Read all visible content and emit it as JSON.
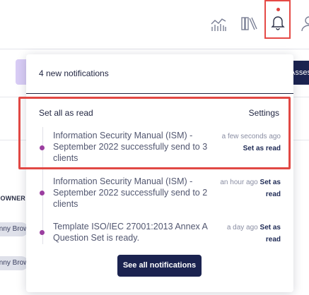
{
  "topbar": {
    "icons": [
      "chart-icon",
      "library-icon",
      "bell-icon",
      "user-icon"
    ],
    "bell_has_unread": true
  },
  "background": {
    "right_button_label": "Assessm",
    "owner_column_header": "CLIENT OWNER",
    "owner_rows": [
      "Danny Brown",
      "Danny Brown"
    ]
  },
  "notifications_panel": {
    "header": "4 new notifications",
    "set_all_read": "Set all as read",
    "settings": "Settings",
    "items": [
      {
        "text": "Information Security Manual (ISM) - September 2022 successfully send to 3 clients",
        "time": "a few seconds ago",
        "action": "Set as read",
        "unread": true
      },
      {
        "text": "Information Security Manual (ISM) - September 2022 successfully send to 2 clients",
        "time": "an hour ago",
        "action": "Set as read",
        "unread": true
      },
      {
        "text": "Template ISO/IEC 27001:2013 Annex A Question Set is ready.",
        "time": "a day ago",
        "action": "Set as read",
        "unread": true
      }
    ],
    "see_all": "See all notifications"
  },
  "colors": {
    "accent_navy": "#1b2350",
    "unread_dot": "#9b3ea0",
    "highlight_red": "#e14844",
    "purple_button": "#d8ccf5"
  }
}
